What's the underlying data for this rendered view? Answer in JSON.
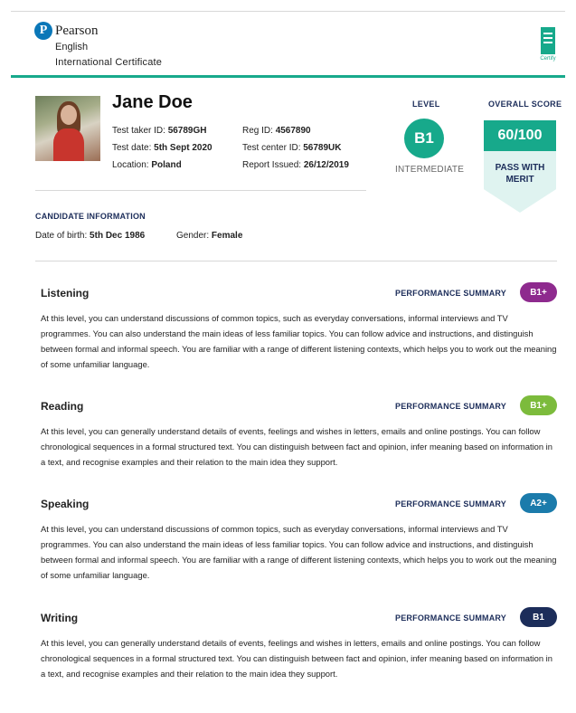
{
  "brand": {
    "logo_letter": "P",
    "name": "Pearson",
    "product": "English",
    "certificate": "International Certificate",
    "certify_label": "Certify"
  },
  "candidate": {
    "name": "Jane Doe",
    "test_taker_id": {
      "label": "Test taker ID:",
      "value": "56789GH"
    },
    "test_date": {
      "label": "Test date:",
      "value": "5th Sept 2020"
    },
    "location": {
      "label": "Location:",
      "value": "Poland"
    },
    "reg_id": {
      "label": "Reg ID:",
      "value": "4567890"
    },
    "test_center_id": {
      "label": "Test center ID:",
      "value": "56789UK"
    },
    "report_issued": {
      "label": "Report Issued:",
      "value": "26/12/2019"
    }
  },
  "level": {
    "label": "LEVEL",
    "value": "B1",
    "description": "INTERMEDIATE"
  },
  "overall": {
    "label": "OVERALL SCORE",
    "score": "60/100",
    "result_line1": "PASS WITH",
    "result_line2": "MERIT"
  },
  "candidate_information": {
    "title": "CANDIDATE INFORMATION",
    "dob": {
      "label": "Date of birth:",
      "value": "5th Dec 1986"
    },
    "gender": {
      "label": "Gender:",
      "value": "Female"
    }
  },
  "skills": [
    {
      "name": "Listening",
      "summary_label": "PERFORMANCE SUMMARY",
      "level": "B1+",
      "color": "#8e2a8e",
      "description": "At this level, you can understand discussions of common topics, such as everyday conversations, informal interviews and TV programmes. You can also understand the main ideas of less familiar topics. You can follow advice and instructions, and distinguish between formal and informal speech. You are familiar with a range of different listening contexts, which helps you to work out the meaning of some unfamiliar language."
    },
    {
      "name": "Reading",
      "summary_label": "PERFORMANCE SUMMARY",
      "level": "B1+",
      "color": "#7cbb3c",
      "description": "At this level, you can generally understand details of events, feelings and wishes in letters, emails and online postings. You can follow chronological sequences in a formal structured text. You can distinguish between fact and opinion, infer meaning based on information in a text, and recognise examples and their relation to the main idea they support."
    },
    {
      "name": "Speaking",
      "summary_label": "PERFORMANCE SUMMARY",
      "level": "A2+",
      "color": "#1b7bab",
      "description": "At this level, you can understand discussions of common topics, such as everyday conversations, informal interviews and TV programmes. You can also understand the main ideas of less familiar topics. You can follow advice and instructions, and distinguish between formal and informal speech. You are familiar with a range of different listening contexts, which helps you to work out the meaning of some unfamiliar language."
    },
    {
      "name": "Writing",
      "summary_label": "PERFORMANCE SUMMARY",
      "level": "B1",
      "color": "#1c2d5a",
      "description": "At this level, you can generally understand details of events, feelings and wishes in letters, emails and online postings. You can follow chronological sequences in a formal structured text. You can distinguish between fact and opinion, infer meaning based on information in a text, and recognise examples and their relation to the main idea they support."
    }
  ],
  "colors": {
    "accent": "#17a98b",
    "navy": "#1c2d5a"
  }
}
